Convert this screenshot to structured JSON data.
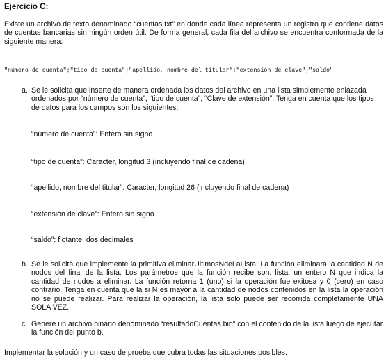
{
  "title": "Ejercicio C:",
  "intro": "Existe un archivo de texto denominado “cuentas.txt” en donde cada línea representa un registro que contiene datos de cuentas bancarias sin ningún orden útil. De forma general, cada fila del archivo se encuentra conformada de la siguiente manera:",
  "record_format": "\"número de cuenta\";\"tipo de cuenta\";\"apellido, nombre del titular\";\"extensión de clave\";\"saldo\".",
  "items": [
    {
      "marker": "a.",
      "text": "Se le solicita que inserte de manera ordenada los datos del archivo en una lista simplemente enlazada ordenados por “número de cuenta”, “tipo de cuenta”, “Clave de extensión”. Tenga en cuenta que los tipos de datos para los campos son los siguientes:",
      "fields": [
        "“número de cuenta”: Entero sin signo",
        "“tipo de cuenta”: Caracter, longitud 3 (incluyendo final de cadena)",
        "“apellido, nombre del titular”: Caracter, longitud 26 (incluyendo final de cadena)",
        "“extensión de clave”: Entero sin signo",
        "“saldo”: flotante, dos decimales"
      ]
    },
    {
      "marker": "b.",
      "text": "Se le solicita que implemente la primitiva eliminarUltimosNdeLaLista. La función eliminará la cantidad N de nodos del final de la lista. Los parámetros que la función recibe son: lista, un entero N que indica la cantidad de nodos a eliminar. La función retorna 1 (uno) si la operación fue exitosa y 0 (cero) en caso contrario. Tenga en cuenta que la si N es mayor a la cantidad de nodos contenidos en la lista la operación no se puede realizar. Para realizar la operación, la lista solo puede ser recorrida completamente UNA SOLA VEZ."
    },
    {
      "marker": "c.",
      "text": "Genere un archivo binario denominado “resultadoCuentas.bin” con el contenido de la lista luego de ejecutar la función del punto b."
    }
  ],
  "closing": "Implementar la solución y un caso de prueba que cubra todas las situaciones posibles."
}
